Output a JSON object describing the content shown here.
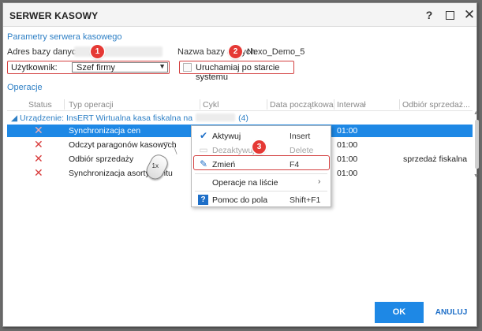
{
  "window": {
    "title": "SERWER KASOWY",
    "help_label": "?",
    "close_label": "✕"
  },
  "params": {
    "section_title": "Parametry serwera kasowego",
    "address_label": "Adres bazy danych:",
    "db_name_label": "Nazwa bazy danych:",
    "db_name_value": "Nexo_Demo_5",
    "user_label": "Użytkownik:",
    "user_value": "Szef firmy",
    "autostart_label": "Uruchamiaj po starcie systemu"
  },
  "callouts": {
    "b1": "1",
    "b2": "2",
    "b3": "3"
  },
  "operations": {
    "section_title": "Operacje",
    "columns": [
      "Status",
      "Typ operacji",
      "Cykl",
      "Data początkowa",
      "Interwał",
      "Odbiór sprzedaż..."
    ],
    "group_label": "Urządzenie: InsERT Wirtualna kasa fiskalna na",
    "group_count": "(4)",
    "rows": [
      {
        "type": "Synchronizacja cen",
        "interval": "01:00",
        "extra": ""
      },
      {
        "type": "Odczyt paragonów kasowych",
        "interval": "01:00",
        "extra": ""
      },
      {
        "type": "Odbiór sprzedaży",
        "interval": "01:00",
        "extra": "sprzedaż fiskalna"
      },
      {
        "type": "Synchronizacja asortymentu",
        "interval": "01:00",
        "extra": ""
      }
    ]
  },
  "mouse_label": "1x",
  "context_menu": {
    "items": [
      {
        "label": "Aktywuj",
        "shortcut": "Insert"
      },
      {
        "label": "Dezaktywuj",
        "shortcut": "Delete"
      },
      {
        "label": "Zmień",
        "shortcut": "F4"
      },
      {
        "label": "Operacje na liście",
        "shortcut": ""
      },
      {
        "label": "Pomoc do pola",
        "shortcut": "Shift+F1"
      }
    ]
  },
  "footer": {
    "ok_label": "OK",
    "cancel_label": "ANULUJ"
  },
  "colors": {
    "accent": "#1e88e5",
    "callout": "#e53935",
    "section_title": "#2d7fc5"
  }
}
